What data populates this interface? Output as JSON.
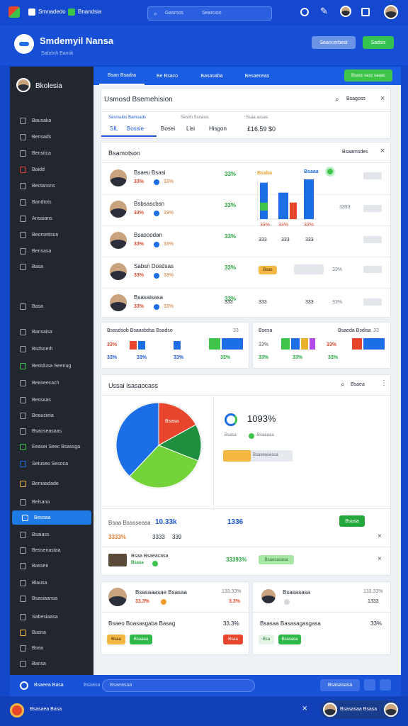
{
  "topbar": {
    "app1": "Smnadedo",
    "app2": "Bnandsia",
    "search_left": "Gasmos",
    "search_right": "Searcion"
  },
  "brand": {
    "title": "Smdemyil Nansa",
    "subtitle": "Sabdnh Bantik",
    "btn_blue": "Seancerbest",
    "btn_green": "Sadsis"
  },
  "sidebar": {
    "profile_name": "Bkolesia",
    "items": [
      {
        "label": "Bausaka"
      },
      {
        "label": "Bensads"
      },
      {
        "label": "Bensitca"
      },
      {
        "label": "Baidd"
      },
      {
        "label": "Bectansns"
      },
      {
        "label": "Bandtots"
      },
      {
        "label": "Ansaians"
      },
      {
        "label": "Beorsettsun"
      },
      {
        "label": "Bensasa"
      },
      {
        "label": "Basa"
      },
      {
        "label": "Basa"
      },
      {
        "label": "Bansaisa"
      },
      {
        "label": "Bsdsoerh"
      },
      {
        "label": "Bestdusa Seenug"
      },
      {
        "label": "Beaseecach"
      },
      {
        "label": "Bessaas"
      },
      {
        "label": "Beaucieia"
      },
      {
        "label": "Bsaoseasaas"
      },
      {
        "label": "Eeasei Seec Bsassga"
      },
      {
        "label": "Setuseo Sesoca"
      },
      {
        "label": "Bemaadade"
      },
      {
        "label": "Belsana"
      },
      {
        "label": "Bessaa"
      },
      {
        "label": "Bsaiass"
      },
      {
        "label": "Bessenastaa"
      },
      {
        "label": "Bassen"
      },
      {
        "label": "Blausa"
      },
      {
        "label": "Bsasiaansa"
      },
      {
        "label": "Sabesiaasa"
      },
      {
        "label": "Basna"
      },
      {
        "label": "Bsea"
      },
      {
        "label": "Bansa"
      }
    ]
  },
  "tabs": [
    "Bsan Bsadra",
    "Be Bsaco",
    "Basasaba",
    "Besaeceas"
  ],
  "tab_button": "Bsasc sasc saaac",
  "overview": {
    "title": "Usmosd Bsemehision",
    "search": "Bsagoss",
    "stat1_label": "Sesnsubs Bamsads",
    "stat1_a": "SIL",
    "stat1_b": "Bossie",
    "stat2_label": "Sesnh Ssnasis",
    "stat2_a": "Bosei",
    "stat2_b": "Lisi",
    "stat2_c": "Hisgon",
    "stat3_label": "Ssaa assas",
    "stat3_value": "£16.59 $0"
  },
  "list": {
    "title": "Bsamotson",
    "action": "Bsaamsdes",
    "rows": [
      {
        "name": "Bsaeu Bsasi",
        "pct": "33%",
        "a": "33%",
        "b": "33%",
        "tag": "Bsaba",
        "tag2": "Bsaaa"
      },
      {
        "name": "Bsbsascbsn",
        "pct": "33%",
        "a": "33%",
        "b": "33%",
        "col": "33%",
        "val": "3393"
      },
      {
        "name": "Bsasoodan",
        "pct": "33%",
        "a": "33%",
        "b": "33%",
        "col": "333",
        "val": "333"
      },
      {
        "name": "Sabsn Dosdsas",
        "pct": "33%",
        "a": "33%",
        "b": "33%",
        "tag": "Bsas",
        "val": "33%"
      },
      {
        "name": "Bsasaisasa",
        "pct": "33%",
        "a": "33%",
        "b": "33%",
        "col": "333",
        "val": "33%"
      }
    ],
    "bar_labels": [
      "Bsa",
      "Bsa",
      "Bsa"
    ],
    "bar_footer": [
      "33%",
      "33%",
      "33%"
    ]
  },
  "summaries": [
    {
      "title": "Bsasdsob Bsaasbdsa Bsadso",
      "badge": "33",
      "p1": "33%",
      "p2": "33%",
      "p3": "33%",
      "p4": "33%",
      "p5": "33%"
    },
    {
      "title": "Bsesa",
      "title2": "Bsaeda Bsdisa",
      "badge": "33",
      "p1": "33%",
      "p2": "33%",
      "p3": "33%",
      "p4": "33%",
      "p5": "33%"
    }
  ],
  "pie_panel": {
    "title": "Ussai Isasaocass",
    "search": "Bsaea",
    "slice_label": "Bsasa",
    "big_value": "1093%",
    "legend1": "Bsasa",
    "legend2": "Bsaeaaa",
    "bar_text": "Bsaseasesca",
    "foot_label": "Bsaa Bsasseasa",
    "foot_v1": "10.33k",
    "foot_v2": "1336",
    "foot_btn": "Bsasa",
    "foot_r1": "3333%",
    "foot_r2": "3333",
    "foot_r3": "339",
    "sub_name": "Bsaa Bsaeacasa",
    "sub_tag": "Bsasa",
    "sub_val": "33393%",
    "sub_pill": "Bsaesasasa"
  },
  "profiles": [
    {
      "name": "Bsasaaasae Bsasaa",
      "right": "133.33%",
      "val": "33.3%",
      "val2": "3.3%",
      "line": "Bsaeo Boasasgaba Basag",
      "line_v": "33.3%",
      "pill1": "Bsaa",
      "pill2": "Bsaaaa",
      "pill3": "Bsaa"
    },
    {
      "name": "Bsasasasa",
      "right": "133.33%",
      "val": "1333",
      "line": "Bsasaa Basasagasgasa",
      "line_v": "33%",
      "pill1": "Bsa",
      "pill2": "Bsasasa"
    }
  ],
  "footer": {
    "left": "Bsaeea Basa",
    "mid": "Bsaasa",
    "input_placeholder": "Bsaeasaa",
    "btn": "Bsasasasa"
  },
  "bottom": {
    "left": "Bsasaea Basa",
    "right": "Bsasasaa Bsasa"
  },
  "colors": {
    "brand_blue": "#1448cf",
    "accent_green": "#2db84a",
    "accent_red": "#e04a2f",
    "chart_blue": "#1c6ee6",
    "chart_green": "#3ec44a"
  },
  "chart_data": {
    "type": "pie",
    "values": [
      38,
      17,
      14,
      31
    ],
    "colors": [
      "#1c6ee6",
      "#e8452d",
      "#1e8f3c",
      "#74d33a"
    ],
    "labels": []
  },
  "bar_chart": {
    "type": "bar",
    "values": [
      55,
      40,
      30,
      55,
      25,
      60
    ],
    "colors": [
      "#1c6ee6",
      "#3ec44a",
      "#1c6ee6",
      "#1c6ee6",
      "#e8452d",
      "#1c6ee6"
    ]
  }
}
